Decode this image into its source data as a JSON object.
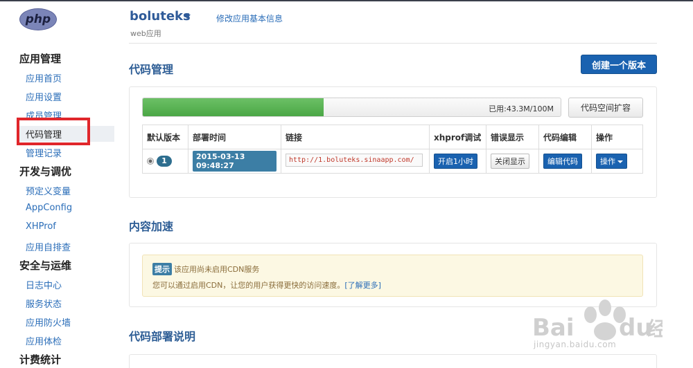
{
  "logo": "php",
  "sidebar": {
    "sections": [
      {
        "title": "应用管理",
        "items": [
          "应用首页",
          "应用设置",
          "成员管理",
          "代码管理",
          "管理记录"
        ]
      },
      {
        "title": "开发与调优",
        "items": [
          "预定义变量",
          "AppConfig",
          "XHProf",
          "应用自排查"
        ]
      },
      {
        "title": "安全与运维",
        "items": [
          "日志中心",
          "服务状态",
          "应用防火墙",
          "应用体检"
        ]
      },
      {
        "title": "计费统计",
        "items": []
      }
    ]
  },
  "header": {
    "app_name": "boluteks",
    "app_type": "web应用",
    "edit_link": "修改应用基本信息"
  },
  "code_mgmt": {
    "title": "代码管理",
    "create_button": "创建一个版本",
    "usage_fraction": 0.433,
    "usage_text": "已用:43.3M/100M",
    "expand_button": "代码空间扩容",
    "table": {
      "headers": [
        "默认版本",
        "部署时间",
        "链接",
        "xhprof调试",
        "错误显示",
        "代码编辑",
        "操作"
      ],
      "row": {
        "version": "1",
        "time": "2015-03-13 09:48:27",
        "url": "http://1.boluteks.sinaapp.com/",
        "xhprof": "开启1小时",
        "error": "关闭显示",
        "edit": "编辑代码",
        "action": "操作"
      }
    }
  },
  "cdn": {
    "title": "内容加速",
    "tip_badge": "提示",
    "tip_line1": "该应用尚未启用CDN服务",
    "tip_line2": "您可以通过启用CDN，让您的用户获得更快的访问速度。",
    "learn_more": "[了解更多]"
  },
  "deploy": {
    "title": "代码部署说明"
  },
  "watermark": {
    "brand": "Bai",
    "brand2": "du",
    "label": "经验",
    "url": "jingyan.baidu.com"
  }
}
